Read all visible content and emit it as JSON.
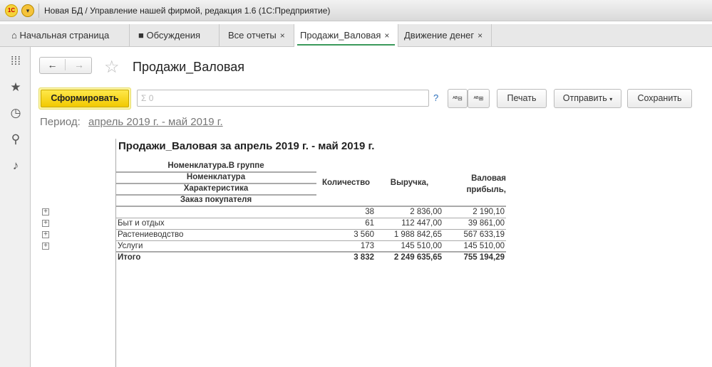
{
  "window": {
    "title": "Новая БД / Управление нашей фирмой, редакция 1.6  (1С:Предприятие)",
    "logo": "1С"
  },
  "tabs": [
    {
      "label": "Начальная страница",
      "icon": "home-icon"
    },
    {
      "label": "Обсуждения",
      "icon": "chat-icon"
    },
    {
      "label": "Все отчеты",
      "close": "×"
    },
    {
      "label": "Продажи_Валовая",
      "close": "×",
      "active": true
    },
    {
      "label": "Движение денег",
      "close": "×"
    }
  ],
  "sidebar": [
    "menu-grid-icon",
    "favorites-star-icon",
    "history-icon",
    "search-icon",
    "notifications-bell-icon"
  ],
  "page": {
    "title": "Продажи_Валовая",
    "back": "←",
    "forward": "→",
    "star": "☆"
  },
  "toolbar": {
    "generate": "Сформировать",
    "search_placeholder": "Σ 0",
    "help": "?",
    "print": "Печать",
    "send": "Отправить",
    "save": "Сохранить"
  },
  "period": {
    "label": "Период:",
    "value": "апрель 2019 г. - май 2019 г."
  },
  "report": {
    "title": "Продажи_Валовая за апрель 2019 г. - май 2019 г.",
    "group_headers": [
      "Номенклатура.В группе",
      "Номенклатура",
      "Характеристика",
      "Заказ покупателя"
    ],
    "columns": [
      "Количество",
      "Выручка,",
      "Валовая прибыль,"
    ],
    "rows": [
      {
        "name": "",
        "qty": "38",
        "revenue": "2 836,00",
        "profit": "2 190,10"
      },
      {
        "name": "Быт и отдых",
        "qty": "61",
        "revenue": "112 447,00",
        "profit": "39 861,00"
      },
      {
        "name": "Растениеводство",
        "qty": "3 560",
        "revenue": "1 988 842,65",
        "profit": "567 633,19"
      },
      {
        "name": "Услуги",
        "qty": "173",
        "revenue": "145 510,00",
        "profit": "145 510,00"
      }
    ],
    "total": {
      "name": "Итого",
      "qty": "3 832",
      "revenue": "2 249 635,65",
      "profit": "755 194,29"
    }
  }
}
